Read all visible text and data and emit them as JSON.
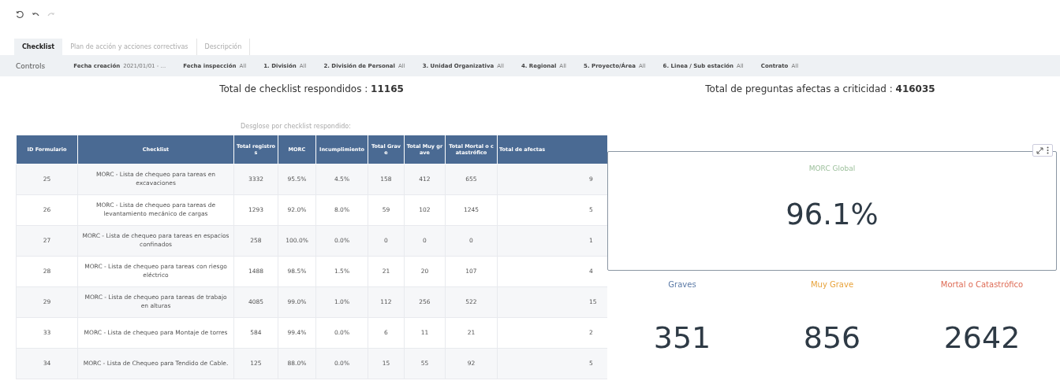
{
  "tabs": [
    {
      "label": "Checklist",
      "selected": true
    },
    {
      "label": "Plan de acción y acciones correctivas",
      "selected": false
    },
    {
      "label": "Descripción",
      "selected": false
    }
  ],
  "controls": {
    "label": "Controls",
    "filters": [
      {
        "name": "Fecha creación",
        "value": "2021/01/01 - ..."
      },
      {
        "name": "Fecha inspección",
        "value": "All"
      },
      {
        "name": "1. División",
        "value": "All"
      },
      {
        "name": "2. División de Personal",
        "value": "All"
      },
      {
        "name": "3. Unidad Organizativa",
        "value": "All"
      },
      {
        "name": "4. Regional",
        "value": "All"
      },
      {
        "name": "5. Proyecto/Área",
        "value": "All"
      },
      {
        "name": "6. Linea / Sub estación",
        "value": "All"
      },
      {
        "name": "Contrato",
        "value": "All"
      }
    ]
  },
  "totals": [
    {
      "label": "Total de checklist respondidos : ",
      "value": "11165"
    },
    {
      "label": "Total de preguntas afectas a criticidad : ",
      "value": "416035"
    }
  ],
  "table": {
    "caption": "Desglose por checklist respondido:",
    "columns": [
      "ID Formulario",
      "Checklist",
      "Total registros",
      "MORC",
      "Incumplimiento",
      "Total Grave",
      "Total Muy grave",
      "Total Mortal o catastrófico",
      "Total de afectas"
    ],
    "rows": [
      [
        "25",
        "MORC - Lista de chequeo para tareas en excavaciones",
        "3332",
        "95.5%",
        "4.5%",
        "158",
        "412",
        "655",
        "9"
      ],
      [
        "26",
        "MORC - Lista de chequeo para tareas de levantamiento mecánico de cargas",
        "1293",
        "92.0%",
        "8.0%",
        "59",
        "102",
        "1245",
        "5"
      ],
      [
        "27",
        "MORC - Lista de chequeo para tareas en espacios confinados",
        "258",
        "100.0%",
        "0.0%",
        "0",
        "0",
        "0",
        "1"
      ],
      [
        "28",
        "MORC - Lista de chequeo para tareas con riesgo eléctrico",
        "1488",
        "98.5%",
        "1.5%",
        "21",
        "20",
        "107",
        "4"
      ],
      [
        "29",
        "MORC - Lista de chequeo para tareas de trabajo en alturas",
        "4085",
        "99.0%",
        "1.0%",
        "112",
        "256",
        "522",
        "15"
      ],
      [
        "33",
        "MORC - Lista de chequeo para Montaje de torres",
        "584",
        "99.4%",
        "0.0%",
        "6",
        "11",
        "21",
        "2"
      ],
      [
        "34",
        "MORC - Lista de Chequeo para Tendido de Cable.",
        "125",
        "88.0%",
        "0.0%",
        "15",
        "55",
        "92",
        "5"
      ]
    ]
  },
  "kpi_main": {
    "title": "MORC Global",
    "value": "96.1%"
  },
  "kpis": [
    {
      "label": "Graves",
      "value": "351",
      "color": "#5b7aa6"
    },
    {
      "label": "Muy Grave",
      "value": "856",
      "color": "#e8a33c"
    },
    {
      "label": "Mortal o Catastrófico",
      "value": "2642",
      "color": "#de6b55"
    }
  ]
}
